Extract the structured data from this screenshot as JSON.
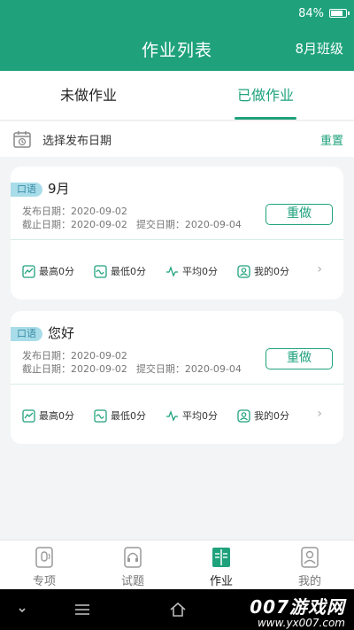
{
  "status": {
    "battery": "84%",
    "battery_level": 0.84
  },
  "header": {
    "title": "作业列表",
    "class_label": "8月班级"
  },
  "tabs": [
    {
      "label": "未做作业",
      "active": false
    },
    {
      "label": "已做作业",
      "active": true
    }
  ],
  "filter": {
    "label": "选择发布日期",
    "reset": "重置"
  },
  "cards": [
    {
      "badge": "口语",
      "title": "9月",
      "publish": "发布日期：2020-09-02",
      "deadline": "截止日期：2020-09-02",
      "submit": "提交日期：2020-09-04",
      "redo": "重做",
      "stats": {
        "max": "最高0分",
        "min": "最低0分",
        "avg": "平均0分",
        "mine": "我的0分"
      }
    },
    {
      "badge": "口语",
      "title": "您好",
      "publish": "发布日期：2020-09-02",
      "deadline": "截止日期：2020-09-02",
      "submit": "提交日期：2020-09-04",
      "redo": "重做",
      "stats": {
        "max": "最高0分",
        "min": "最低0分",
        "avg": "平均0分",
        "mine": "我的0分"
      }
    }
  ],
  "bottom_nav": [
    {
      "label": "专项",
      "icon": "microphone-icon"
    },
    {
      "label": "试题",
      "icon": "headphones-icon"
    },
    {
      "label": "作业",
      "icon": "book-icon",
      "active": true
    },
    {
      "label": "我的",
      "icon": "person-icon"
    }
  ],
  "watermark": {
    "big": "007游戏网",
    "small": "www.yx007.com"
  },
  "colors": {
    "accent": "#1fa27c",
    "badge_bg": "#a9dce9"
  }
}
